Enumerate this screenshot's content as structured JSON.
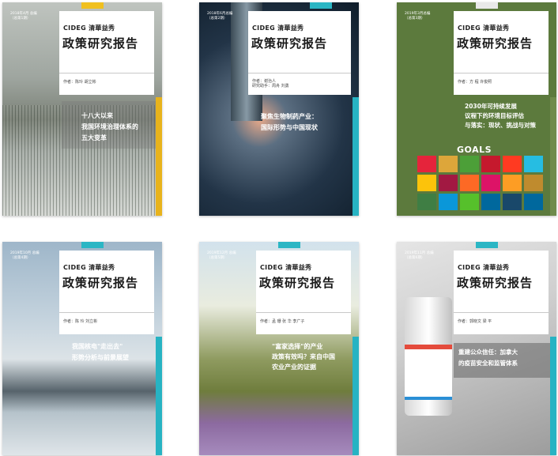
{
  "colors": {
    "panel": "#ffffff",
    "accent_teal": "#2bb6c4",
    "accent_yellow": "#e8b31c",
    "accent_green": "#6f8b4c",
    "sdg_colors": [
      "#e5243b",
      "#dda63a",
      "#4c9f38",
      "#c5192d",
      "#ff3a21",
      "#26bde2",
      "#fcc30b",
      "#a21942",
      "#fd6925",
      "#dd1367",
      "#fd9d24",
      "#bf8b2e",
      "#3f7e44",
      "#0a97d9",
      "#56c02b",
      "#00689d",
      "#19486a",
      "#00689d"
    ]
  },
  "reports": [
    {
      "date": "2018年4月 总编\n（总第1期）",
      "brand": "CIDEG 清華益秀",
      "title": "政策研究报告",
      "authors": "作者：陈玲 胡立彬",
      "subtitle": "十八大以来\n我国环境治理体系的\n五大变革"
    },
    {
      "date": "2018年6月总编\n（总第2期）",
      "brand": "CIDEG 清華益秀",
      "title": "政策研究报告",
      "authors": "作者：谢治人\n研究助手：周舟 刘勇",
      "subtitle": "聚焦生物制药产业：\n国际形势与中国现状"
    },
    {
      "date": "2019年3月总编\n（总第3期）",
      "brand": "CIDEG 清華益秀",
      "title": "政策研究报告",
      "authors": "作者：方 程 许俊照",
      "subtitle": "2030年可持续发展\n议程下的环境目标评估\n与落实：现状、挑战与对策",
      "sdg_label": "GOALS"
    },
    {
      "date": "2019年10月 总编\n（总第4期）",
      "brand": "CIDEG 清華益秀",
      "title": "政策研究报告",
      "authors": "作者：陈 玲 刘立彬",
      "subtitle": "我国核电\"走出去\"\n形势分析与前景展望"
    },
    {
      "date": "2019年12月 总编\n（总第5期）",
      "brand": "CIDEG 清華益秀",
      "title": "政策研究报告",
      "authors": "作者：孟 珊 张 华 李广子",
      "subtitle": "\"富家选择\"的产业\n政策有效吗？来自中国\n农业产业的证据"
    },
    {
      "date": "2019年11月 总编\n（总第6期）",
      "brand": "CIDEG 清華益秀",
      "title": "政策研究报告",
      "authors": "作者：郭晓文 梁 平",
      "subtitle": "重建公众信任：加拿大\n的疫苗安全和监管体系"
    }
  ]
}
